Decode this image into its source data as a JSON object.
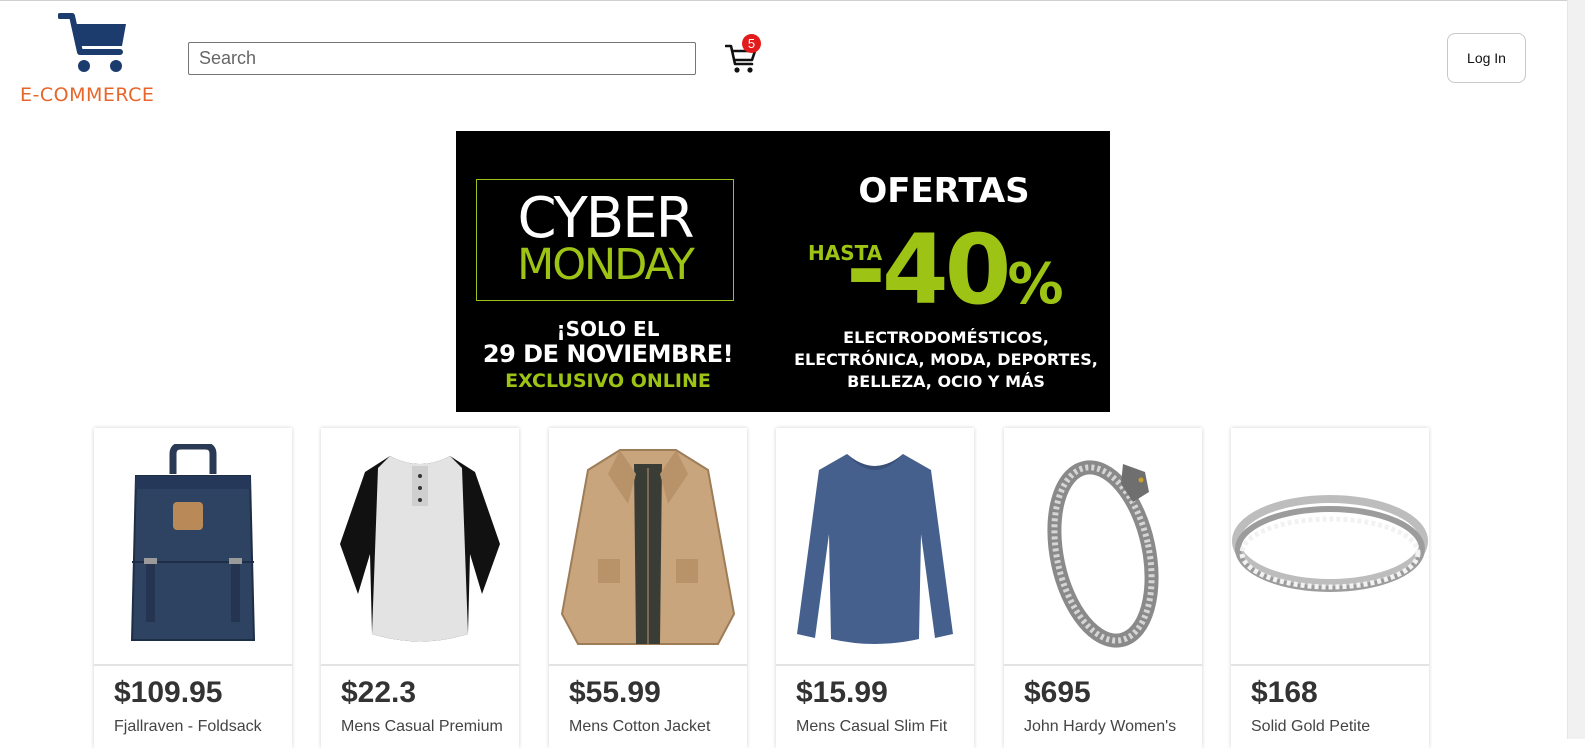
{
  "header": {
    "logo_text": "E-COMMERCE",
    "search_placeholder": "Search",
    "cart_count": "5",
    "login_label": "Log In"
  },
  "banner": {
    "line1": "CYBER",
    "line2": "MONDAY",
    "line3": "¡SOLO EL",
    "line4": "29 DE NOVIEMBRE!",
    "line5": "EXCLUSIVO ONLINE",
    "ofertas": "OFERTAS",
    "hasta": "HASTA",
    "discount": "-40",
    "percent": "%",
    "categories": [
      "ELECTRODOMÉSTICOS,",
      "ELECTRÓNICA, MODA, DEPORTES,",
      "BELLEZA, OCIO Y MÁS"
    ]
  },
  "products": [
    {
      "price": "$109.95",
      "title": "Fjallraven - Foldsack",
      "icon": "backpack-image"
    },
    {
      "price": "$22.3",
      "title": "Mens Casual Premium",
      "icon": "raglan-shirt-image"
    },
    {
      "price": "$55.99",
      "title": "Mens Cotton Jacket",
      "icon": "cotton-jacket-image"
    },
    {
      "price": "$15.99",
      "title": "Mens Casual Slim Fit",
      "icon": "long-sleeve-shirt-image"
    },
    {
      "price": "$695",
      "title": "John Hardy Women's",
      "icon": "dragon-bracelet-image"
    },
    {
      "price": "$168",
      "title": "Solid Gold Petite",
      "icon": "ring-image"
    }
  ],
  "colors": {
    "logo_blue": "#1d3c6e",
    "logo_orange": "#e8652b",
    "badge_red": "#e31b1b",
    "banner_green": "#9dc315",
    "banner_bg": "#000000"
  }
}
